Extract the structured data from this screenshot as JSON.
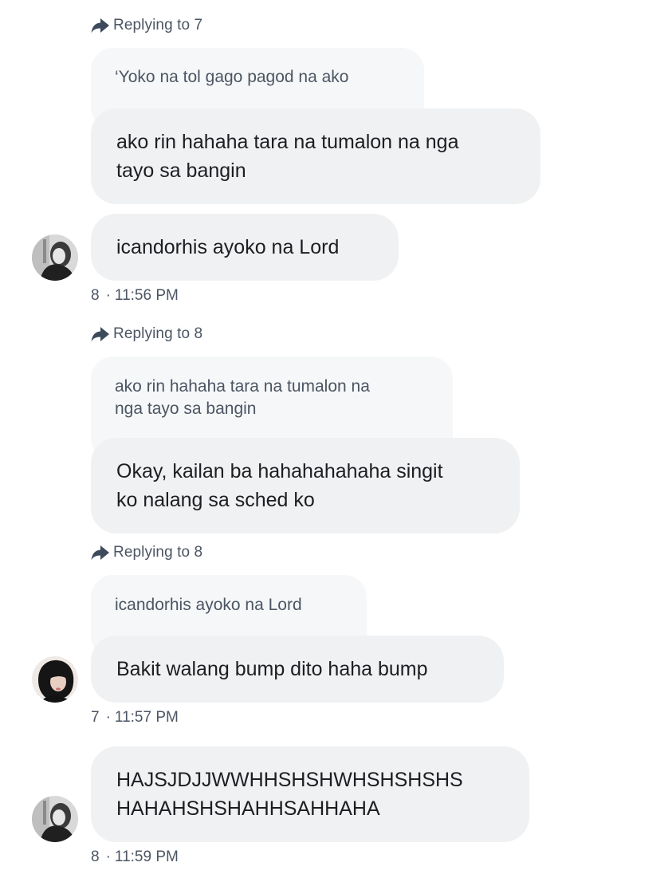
{
  "thread": {
    "m1": {
      "replying_label": "Replying to 7",
      "quote": "‘Yoko na tol gago pagod na ako",
      "text_lines": [
        "ako rin hahaha tara na tumalon na nga",
        "tayo sa bangin"
      ]
    },
    "m2": {
      "text": "icandorhis ayoko na Lord",
      "author": "8",
      "time": "11:56 PM"
    },
    "m3": {
      "replying_label": "Replying to 8",
      "quote_lines": [
        "ako rin hahaha tara na tumalon na",
        "nga tayo sa bangin"
      ],
      "text_lines": [
        "Okay, kailan ba hahahahahaha singit",
        "ko nalang sa sched ko"
      ]
    },
    "m4": {
      "replying_label": "Replying to 8",
      "quote": "icandorhis ayoko na Lord",
      "text": "Bakit walang bump dito haha bump",
      "author": "7",
      "time": "11:57 PM"
    },
    "m5": {
      "text_lines": [
        "HAJSJDJJWWHHSHSHWHSHSHSHS",
        "HAHAHSHSHAHHSAHHAHA"
      ],
      "author": "8",
      "time": "11:59 PM"
    }
  },
  "meta_separator": "·",
  "icons": {
    "reply": "reply-arrow-icon",
    "avatar_8": "avatar-8",
    "avatar_7": "avatar-7"
  },
  "colors": {
    "bubble_bg": "#eff1f3",
    "quote_bg": "#f6f7f8",
    "muted_text": "#4b5563",
    "text": "#1c1e21"
  }
}
